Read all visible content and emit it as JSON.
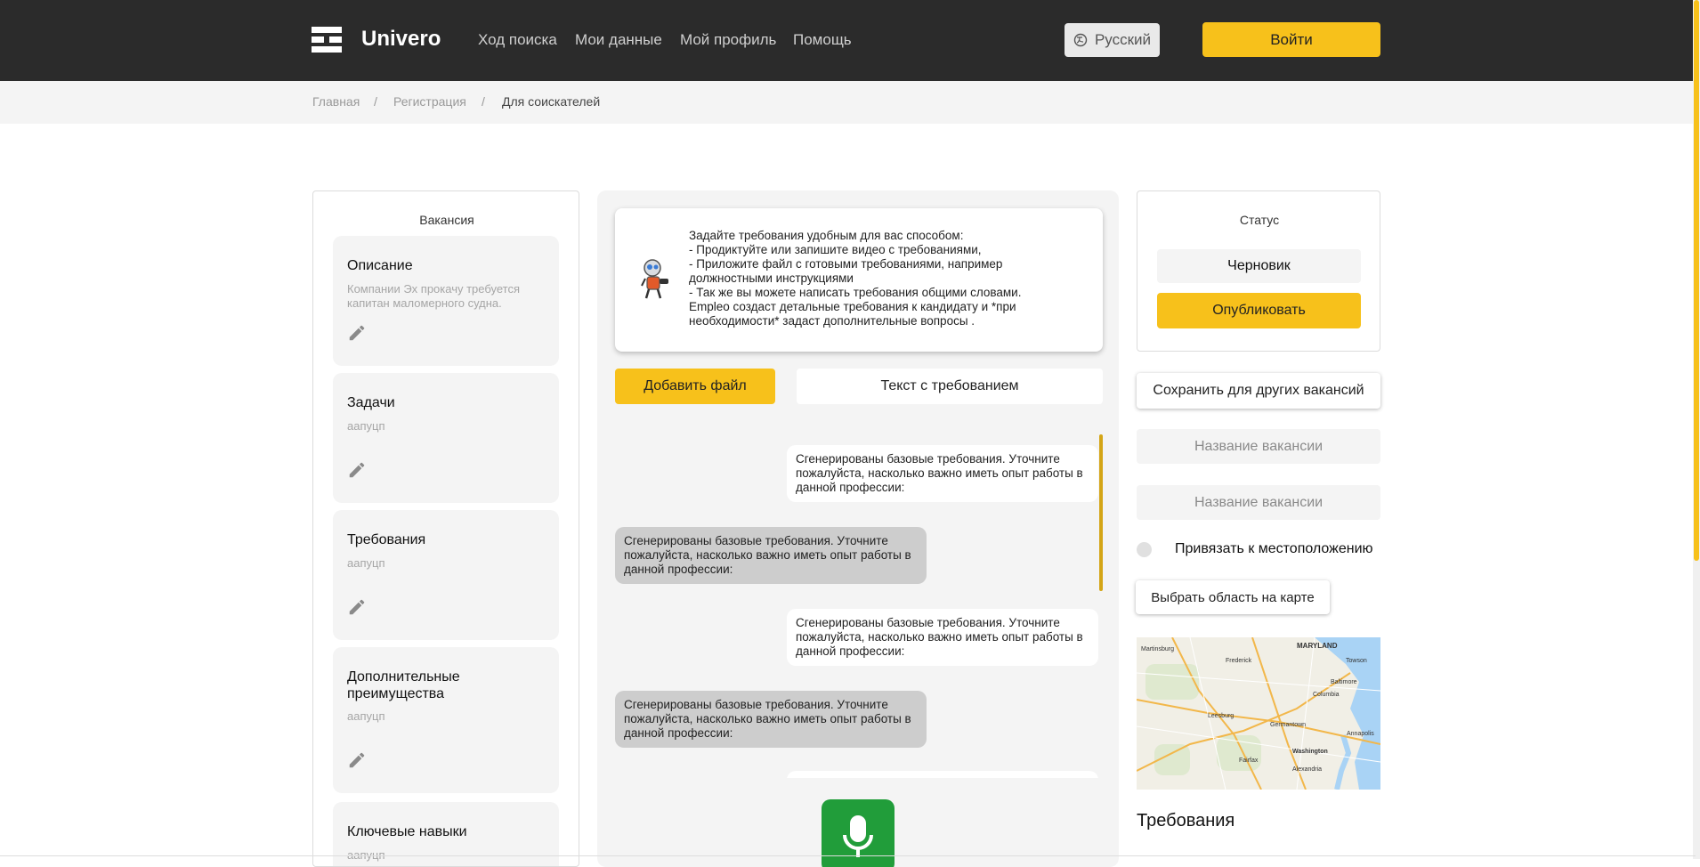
{
  "header": {
    "brand": "Univero",
    "nav": [
      "Ход поиска",
      "Мои данные",
      "Мой профиль",
      "Помощь"
    ],
    "language": "Русский",
    "login": "Войти"
  },
  "breadcrumb": {
    "items": [
      "Главная",
      "/",
      "Регистрация",
      "/",
      "Для соискателей"
    ]
  },
  "left": {
    "title": "Вакансия",
    "cards": [
      {
        "title": "Описание",
        "text": "Компании Эх прокачу требуется капитан маломерного судна."
      },
      {
        "title": "Задачи",
        "text": "аапуцп"
      },
      {
        "title": "Требования",
        "text": "аапуцп"
      },
      {
        "title": "Дополнительные преимущества",
        "text": "аапуцп"
      },
      {
        "title": "Ключевые навыки",
        "text": "аапуцп"
      }
    ]
  },
  "middle": {
    "info": "Задайте требования удобным для вас способом:\n- Продиктуйте или запишите видео с требованиями,\n- Приложите файл с готовыми требованиями, например должностными инструкциями\n- Так же вы можете написать требования общими словами.\nEmpleo создаст детальные требования к кандидату и *при необходимости* задаст дополнительные вопросы .",
    "add_file": "Добавить файл",
    "req_text": "Текст с требованием",
    "messages": [
      "Сгенерированы базовые требования. Уточните пожалуйста, насколько важно иметь опыт работы в данной профессии:",
      "Сгенерированы базовые требования. Уточните пожалуйста, насколько важно иметь опыт работы в данной профессии:",
      "Сгенерированы базовые требования. Уточните пожалуйста, насколько важно иметь опыт работы в данной профессии:",
      "Сгенерированы базовые требования. Уточните пожалуйста, насколько важно иметь опыт работы в данной профессии:"
    ]
  },
  "right": {
    "status_title": "Статус",
    "status_value": "Черновик",
    "publish": "Опубликовать",
    "save_for_others": "Сохранить для других вакансий",
    "field1_placeholder": "Название вакансии",
    "field2_placeholder": "Название вакансии",
    "toggle_label": "Привязать к местоположению",
    "map_button": "Выбрать область на карте",
    "map_labels": [
      "MARYLAND",
      "Baltimore",
      "Towson",
      "Columbia",
      "Washington",
      "Alexandria",
      "Frederick",
      "Leesburg",
      "Martinsburg",
      "Annapolis",
      "Germantown",
      "Fairfax"
    ],
    "requirements_heading": "Требования"
  },
  "colors": {
    "accent": "#f7c11b",
    "header_bg": "#2b2b2b",
    "mic": "#219d3a"
  }
}
